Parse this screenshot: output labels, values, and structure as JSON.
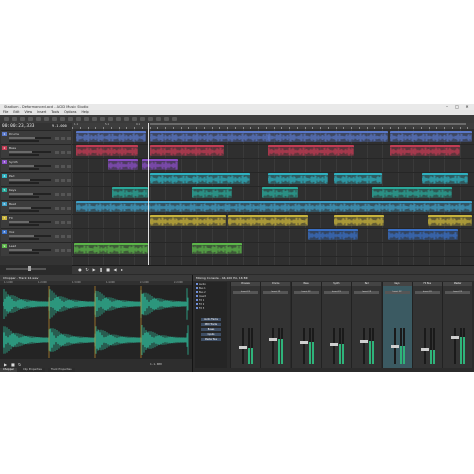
{
  "window": {
    "title": "Stadium - Deformanced.acd - ACID Music Studio",
    "controls": [
      "–",
      "□",
      "✕"
    ]
  },
  "menu": [
    "File",
    "Edit",
    "View",
    "Insert",
    "Tools",
    "Options",
    "Help"
  ],
  "timeline": {
    "time": "00:00:23,333",
    "tempo": "9.1.000",
    "ruler_marks": [
      "1.1",
      "5.1",
      "9.1",
      "13.1",
      "17.1",
      "21.1",
      "25.1",
      "29.1",
      "33.1",
      "37.1",
      "41.1",
      "45.1",
      "49.1"
    ]
  },
  "tracks": [
    {
      "num": "1",
      "name": "Drums",
      "color": "#5a78c8",
      "vol": 0.62
    },
    {
      "num": "2",
      "name": "Bass",
      "color": "#c23c54",
      "vol": 0.55
    },
    {
      "num": "3",
      "name": "Synth",
      "color": "#8a4fc4",
      "vol": 0.6
    },
    {
      "num": "4",
      "name": "Pad",
      "color": "#2fb0bf",
      "vol": 0.5
    },
    {
      "num": "5",
      "name": "Keys",
      "color": "#2aa89a",
      "vol": 0.58
    },
    {
      "num": "6",
      "name": "Beat",
      "color": "#3fa0c8",
      "vol": 0.52
    },
    {
      "num": "7",
      "name": "FX",
      "color": "#c8b33c",
      "vol": 0.48
    },
    {
      "num": "8",
      "name": "Vox",
      "color": "#3a6fc4",
      "vol": 0.6
    },
    {
      "num": "9",
      "name": "Lead",
      "color": "#5cb54a",
      "vol": 0.55
    }
  ],
  "chopper": {
    "title": "Chopper - Track 12.wav",
    "ruler": [
      "1.1.000",
      "1.2.000",
      "1.3.000",
      "1.4.000",
      "2.1.000",
      "2.2.000"
    ],
    "readout": "1.1.000"
  },
  "bottom_tabs": [
    "Chopper",
    "Clip Properties",
    "Track Properties"
  ],
  "mixer": {
    "title": "Mixing Console - 44,100 Hz, 16 Bit",
    "tree": [
      "Audio",
      "Bus 1",
      "Bus 2",
      "Insert",
      "FX 1",
      "FX 2",
      "FX 3"
    ],
    "tree_buttons": [
      "Audio Tracks",
      "MIDI Tracks",
      "Buses",
      "Inputs",
      "Master Bus"
    ],
    "strips": [
      {
        "name": "Preview",
        "slot": "Insert FX",
        "level": 0.45
      },
      {
        "name": "Drums",
        "slot": "Insert FX",
        "level": 0.7
      },
      {
        "name": "Bass",
        "slot": "Insert FX",
        "level": 0.6
      },
      {
        "name": "Synth",
        "slot": "Insert FX",
        "level": 0.55
      },
      {
        "name": "Pad",
        "slot": "Insert FX",
        "level": 0.65
      },
      {
        "name": "Keys",
        "slot": "Insert FX",
        "level": 0.5
      },
      {
        "name": "FX Bus",
        "slot": "Insert FX",
        "level": 0.4
      },
      {
        "name": "Master",
        "slot": "Insert FX",
        "level": 0.75
      }
    ]
  }
}
